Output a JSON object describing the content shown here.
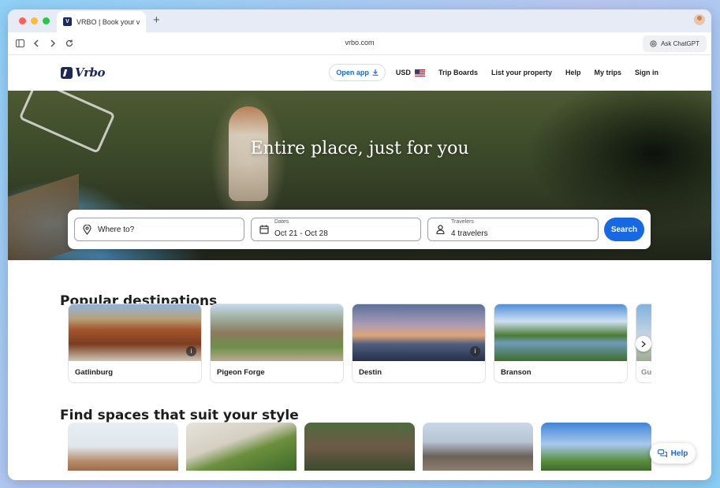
{
  "browser": {
    "tab_title": "VRBO | Book your v",
    "url": "vrbo.com",
    "ask_label": "Ask ChatGPT"
  },
  "header": {
    "logo_text": "Vrbo",
    "open_app": "Open app",
    "currency": "USD",
    "nav": [
      "Trip Boards",
      "List your property",
      "Help",
      "My trips",
      "Sign in"
    ]
  },
  "hero": {
    "title": "Entire place, just for you",
    "where_placeholder": "Where to?",
    "dates_label": "Dates",
    "dates_value": "Oct 21 - Oct 28",
    "travelers_label": "Travelers",
    "travelers_value": "4 travelers",
    "search_label": "Search"
  },
  "popular": {
    "title": "Popular destinations",
    "items": [
      "Gatlinburg",
      "Pigeon Forge",
      "Destin",
      "Branson",
      "Gu"
    ]
  },
  "styles": {
    "title": "Find spaces that suit your style"
  },
  "help_label": "Help",
  "colors": {
    "brand": "#1b2a5c",
    "accent": "#1668e3"
  }
}
